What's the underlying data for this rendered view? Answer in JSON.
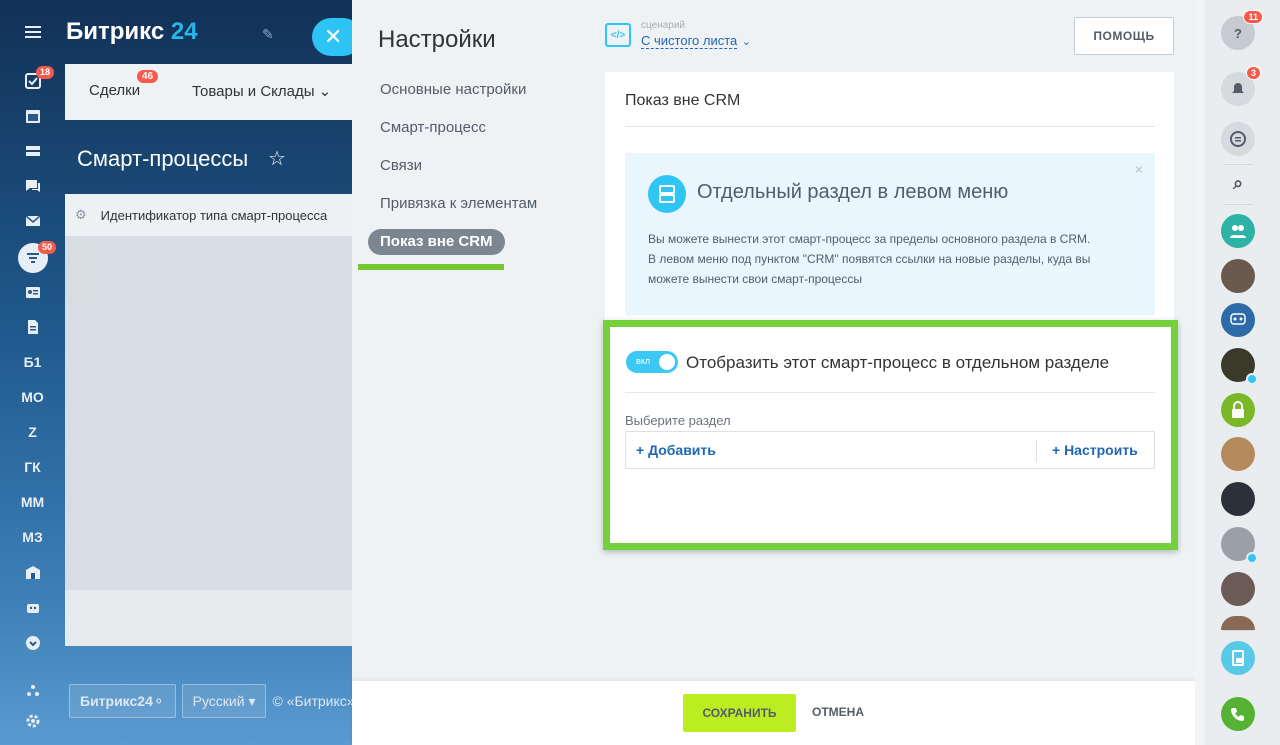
{
  "background": {
    "logo_text": "Битрикс",
    "logo_num": "24",
    "tabs": {
      "deals": "Сделки",
      "deals_badge": "46",
      "goods": "Товары и Склады"
    },
    "page_title": "Смарт-процессы",
    "grid_header": "Идентификатор типа смарт-процесса",
    "left_menu": {
      "badge_tasks": "18",
      "badge_crm": "50",
      "groups": [
        "Б1",
        "МО",
        "Z",
        "ГК",
        "ММ",
        "МЗ"
      ]
    },
    "footer": {
      "brand": "Битрикс24",
      "language": "Русский",
      "copyright": "© «Битрикс»"
    }
  },
  "slider": {
    "title": "Настройки",
    "menu": [
      "Основные настройки",
      "Смарт-процесс",
      "Связи",
      "Привязка к элементам",
      "Показ вне CRM"
    ],
    "scenario": {
      "caption": "сценарий",
      "value": "С чистого листа"
    },
    "help_label": "ПОМОЩЬ",
    "card_title": "Показ вне CRM",
    "info": {
      "title": "Отдельный раздел в левом меню",
      "text_line1": "Вы можете вынести этот смарт-процесс за пределы основного раздела в CRM.",
      "text_line2": "В левом меню под пунктом \"CRM\" появятся ссылки на новые разделы, куда вы",
      "text_line3": "можете вынести свои смарт-процессы",
      "close": "×"
    },
    "toggle": {
      "state_label": "вкл",
      "caption": "Отобразить этот смарт-процесс в отдельном разделе"
    },
    "choose": {
      "label": "Выберите раздел",
      "add": "+ Добавить",
      "configure": "+ Настроить"
    },
    "save_label": "СОХРАНИТЬ",
    "cancel_label": "ОТМЕНА"
  },
  "right_bar": {
    "help_badge": "11",
    "notify_badge": "3"
  },
  "colors": {
    "accent": "#2fc6f6",
    "highlight": "#75d13b",
    "save": "#bbed21",
    "badge": "#f55a4a"
  }
}
